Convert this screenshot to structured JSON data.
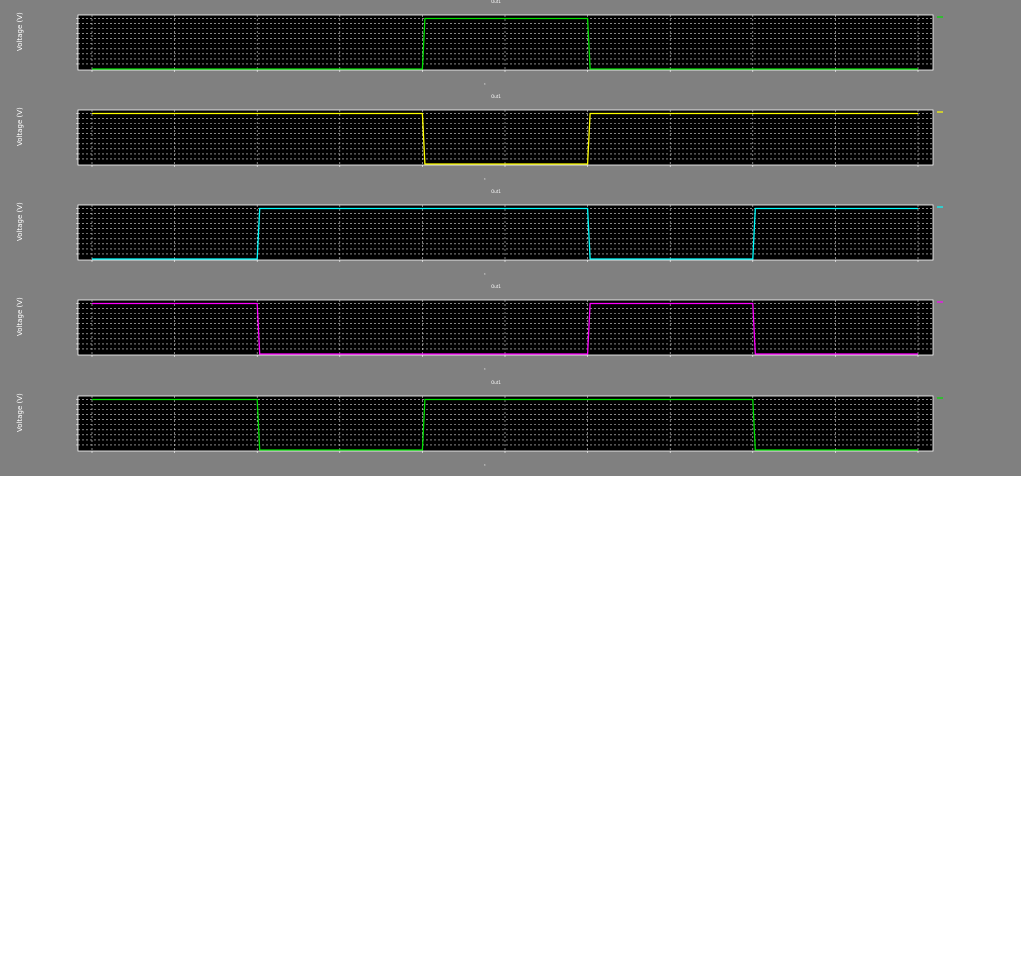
{
  "chart_data": [
    {
      "type": "line",
      "title": "Out1",
      "ylabel": "Voltage (V)",
      "xlabel": "t",
      "xlim": [
        0,
        10.2
      ],
      "ylim": [
        0,
        1.05
      ],
      "grid": true,
      "background": "#000000",
      "series": [
        {
          "name": "",
          "color": "#00e000",
          "x": [
            0,
            4.0,
            4.03,
            6.0,
            6.03,
            10.0
          ],
          "y": [
            0,
            0,
            1,
            1,
            0,
            0
          ]
        }
      ],
      "legend": "top-right"
    },
    {
      "type": "line",
      "title": "Out1",
      "ylabel": "Voltage (V)",
      "xlabel": "t",
      "xlim": [
        0,
        10.2
      ],
      "ylim": [
        0,
        1.05
      ],
      "grid": true,
      "background": "#000000",
      "series": [
        {
          "name": "",
          "color": "#ffff00",
          "x": [
            0,
            4.0,
            4.03,
            6.0,
            6.03,
            10.0
          ],
          "y": [
            1,
            1,
            0,
            0,
            1,
            1
          ]
        }
      ],
      "legend": "top-right"
    },
    {
      "type": "line",
      "title": "Out1",
      "ylabel": "Voltage (V)",
      "xlabel": "t",
      "xlim": [
        0,
        10.2
      ],
      "ylim": [
        0,
        1.05
      ],
      "grid": true,
      "background": "#000000",
      "series": [
        {
          "name": "",
          "color": "#00ffff",
          "x": [
            0,
            2.0,
            2.03,
            6.0,
            6.03,
            8.0,
            8.03,
            10.0
          ],
          "y": [
            0,
            0,
            1,
            1,
            0,
            0,
            1,
            1
          ]
        }
      ],
      "legend": "top-right"
    },
    {
      "type": "line",
      "title": "Out1",
      "ylabel": "Voltage (V)",
      "xlabel": "t",
      "xlim": [
        0,
        10.2
      ],
      "ylim": [
        0,
        1.05
      ],
      "grid": true,
      "background": "#000000",
      "series": [
        {
          "name": "",
          "color": "#ff00ff",
          "x": [
            0,
            2.0,
            2.03,
            6.0,
            6.03,
            8.0,
            8.03,
            10.0
          ],
          "y": [
            1,
            1,
            0,
            0,
            1,
            1,
            0,
            0
          ]
        }
      ],
      "legend": "top-right"
    },
    {
      "type": "line",
      "title": "Out1",
      "ylabel": "Voltage (V)",
      "xlabel": "t",
      "xlim": [
        0,
        10.2
      ],
      "ylim": [
        0,
        1.05
      ],
      "grid": true,
      "background": "#000000",
      "series": [
        {
          "name": "",
          "color": "#00e000",
          "x": [
            0,
            2.0,
            2.03,
            4.0,
            4.03,
            8.0,
            8.03,
            10.0
          ],
          "y": [
            1,
            1,
            0,
            0,
            1,
            1,
            0,
            0
          ]
        }
      ],
      "legend": "top-right"
    }
  ]
}
